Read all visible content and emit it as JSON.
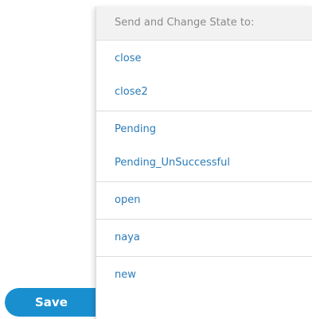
{
  "save_button": {
    "label": "Save"
  },
  "menu": {
    "header": "Send and Change State to:",
    "groups": [
      {
        "items": [
          {
            "label": "close"
          },
          {
            "label": "close2"
          }
        ]
      },
      {
        "items": [
          {
            "label": "Pending"
          },
          {
            "label": "Pending_UnSuccessful"
          }
        ]
      },
      {
        "items": [
          {
            "label": "open"
          }
        ]
      },
      {
        "items": [
          {
            "label": "naya"
          }
        ]
      },
      {
        "items": [
          {
            "label": "new"
          }
        ]
      }
    ]
  },
  "colors": {
    "accent": "#1a8fd0",
    "link": "#2a7bb8",
    "header_bg": "#f2f2f2",
    "header_text": "#8a8a8a"
  }
}
